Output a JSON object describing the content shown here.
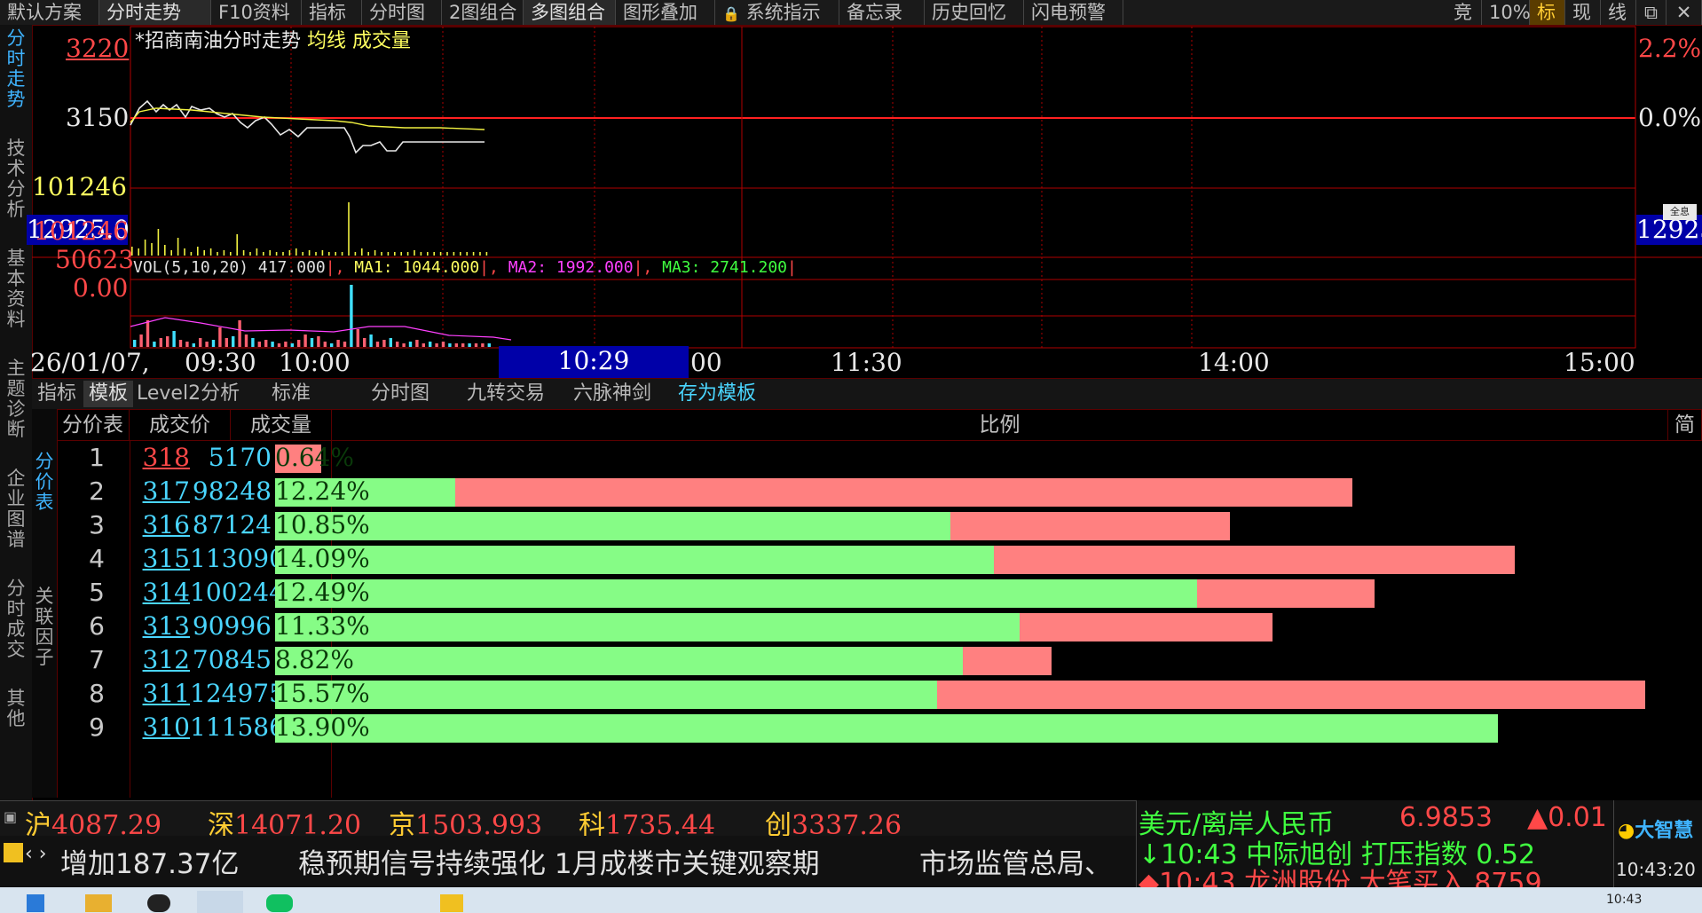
{
  "menu": [
    "默认方案",
    "分时走势",
    "F10资料",
    "指标",
    "分时图",
    "2图组合",
    "多图组合",
    "图形叠加",
    "系统指示",
    "备忘录",
    "历史回忆",
    "闪电预警"
  ],
  "menu_right": [
    "竞",
    "10%",
    "标",
    "现",
    "线"
  ],
  "left_tabs": [
    "分时走势",
    "技术分析",
    "基本资料",
    "主题诊断",
    "企业图谱",
    "分时成交",
    "其他"
  ],
  "chart": {
    "title": "*招商南油",
    "title_suffix": "分时走势",
    "ma_label": "均线",
    "vol_label": "成交量",
    "price_high": "3220",
    "price_mid": "3150",
    "pct_high": "2.2%",
    "pct_mid": "0.0%",
    "vol_max_left": "101246",
    "vol_current_left": "12925.0",
    "vol_current_right": "12925.0",
    "vol_panel_top": "101246",
    "vol_panel_mid": "50623",
    "vol_panel_zero": "0.00",
    "vol_legend": {
      "vol": "VOL(5,10,20) 417.000",
      "ma1": "MA1: 1044.000",
      "ma2": "MA2: 1992.000",
      "ma3": "MA3: 2741.200"
    },
    "time_date": "26/01/07,",
    "time_labels": [
      "09:30",
      "10:00",
      "10:29",
      "00",
      "11:30",
      "14:00",
      "15:00"
    ],
    "side_buttons": [
      "全息"
    ]
  },
  "bottom_tabs": [
    "指标",
    "模板",
    "Level2分析",
    "标准",
    "分时图",
    "九转交易",
    "六脉神剑",
    "存为模板"
  ],
  "side_subtabs": [
    "分价表",
    "关联因子"
  ],
  "table": {
    "headers": [
      "分价表",
      "成交价",
      "成交量",
      "比例",
      "简"
    ],
    "rows": [
      {
        "idx": "1",
        "price": "318",
        "vol": "5170",
        "pct": "0.64%",
        "pct_value": 0.64,
        "buy_fraction": 0.0
      },
      {
        "idx": "2",
        "price": "317",
        "vol": "98248",
        "pct": "12.24%",
        "pct_value": 12.24,
        "buy_fraction": 0.167
      },
      {
        "idx": "3",
        "price": "316",
        "vol": "87124",
        "pct": "10.85%",
        "pct_value": 10.85,
        "buy_fraction": 0.707
      },
      {
        "idx": "4",
        "price": "315",
        "vol": "113090",
        "pct": "14.09%",
        "pct_value": 14.09,
        "buy_fraction": 0.58
      },
      {
        "idx": "5",
        "price": "314",
        "vol": "100244",
        "pct": "12.49%",
        "pct_value": 12.49,
        "buy_fraction": 0.839
      },
      {
        "idx": "6",
        "price": "313",
        "vol": "90996",
        "pct": "11.33%",
        "pct_value": 11.33,
        "buy_fraction": 0.747
      },
      {
        "idx": "7",
        "price": "312",
        "vol": "70845",
        "pct": "8.82%",
        "pct_value": 8.82,
        "buy_fraction": 0.886
      },
      {
        "idx": "8",
        "price": "311",
        "vol": "124975",
        "pct": "15.57%",
        "pct_value": 15.57,
        "buy_fraction": 0.483
      },
      {
        "idx": "9",
        "price": "310",
        "vol": "111586",
        "pct": "13.90%",
        "pct_value": 13.9,
        "buy_fraction": 1.0
      }
    ]
  },
  "indices": [
    {
      "name": "沪",
      "value": "4087.29"
    },
    {
      "name": "深",
      "value": "14071.20"
    },
    {
      "name": "京",
      "value": "1503.993"
    },
    {
      "name": "科",
      "value": "1735.44"
    },
    {
      "name": "创",
      "value": "3337.26"
    }
  ],
  "news": [
    "增加187.37亿",
    "稳预期信号持续强化 1月成楼市关键观察期",
    "市场监管总局、"
  ],
  "fx": {
    "name": "美元/离岸人民币",
    "value": "6.9853",
    "change": "▲0.01"
  },
  "alerts": [
    {
      "time": "10:43",
      "stock": "中际旭创",
      "event": "打压指数",
      "value": "0.52"
    },
    {
      "time": "10:43",
      "stock": "龙洲股份",
      "event": "大笔买入",
      "value": "8759"
    }
  ],
  "clock": {
    "brand": "大智慧",
    "time": "10:43:20",
    "taskbar_time": "10:43"
  },
  "colors": {
    "up": "#ff4848",
    "down": "#86fc86",
    "grid": "#b00000",
    "accent": "#3fb4ff"
  }
}
